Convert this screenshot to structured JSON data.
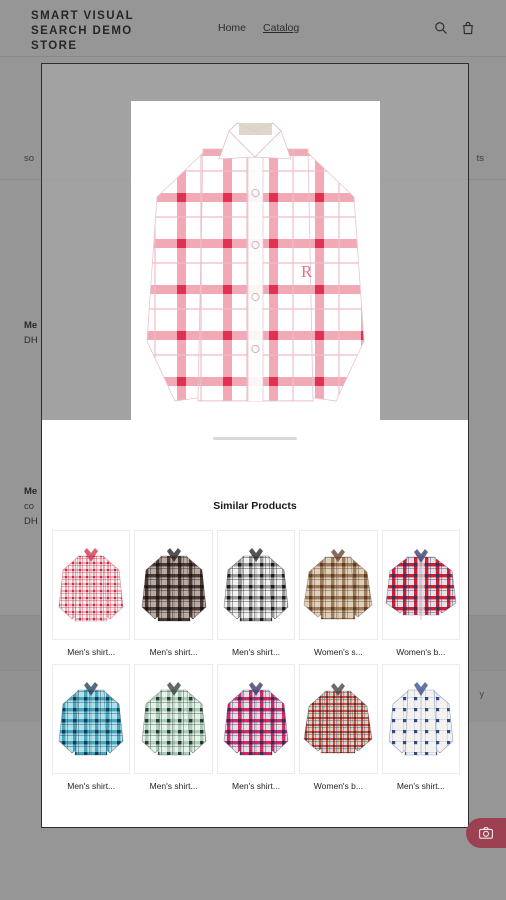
{
  "header": {
    "brand": "SMART VISUAL SEARCH DEMO STORE",
    "nav": [
      {
        "label": "Home",
        "active": false
      },
      {
        "label": "Catalog",
        "active": true
      }
    ],
    "icons": [
      {
        "name": "search-icon",
        "label": "Search"
      },
      {
        "name": "cart-icon",
        "label": "Cart"
      }
    ]
  },
  "background_page": {
    "sort_left": "so",
    "sort_right": "ts",
    "items": [
      {
        "title": "Me",
        "subtitle": "",
        "price": "DH",
        "right": ""
      },
      {
        "title": "Me",
        "subtitle": "co",
        "price": "DH",
        "right": ""
      }
    ],
    "footer_right": "y"
  },
  "modal": {
    "name": "visual-search-result-modal",
    "hero": {
      "name": "queried-product-photo",
      "alt": "Men's white shirt with pink and red plaid checks"
    },
    "sheet_title": "Similar Products",
    "drag_handle": "drag-handle"
  },
  "similar_products": [
    {
      "label": "Men's shirt...",
      "colors": [
        "#f6f4f3",
        "#e9aab4",
        "#cf2b45"
      ],
      "style": "plaid-fine",
      "shape": "mens"
    },
    {
      "label": "Men's shirt...",
      "colors": [
        "#b9aaa3",
        "#4b3b38",
        "#1d1715"
      ],
      "style": "plaid-bold",
      "shape": "mens"
    },
    {
      "label": "Men's shirt...",
      "colors": [
        "#f2f2f2",
        "#9a9a9a",
        "#1c1c1c"
      ],
      "style": "plaid-bold",
      "shape": "mens"
    },
    {
      "label": "Women's s...",
      "colors": [
        "#ded0bd",
        "#9d7c58",
        "#5d3a2a"
      ],
      "style": "plaid-bold",
      "shape": "womens"
    },
    {
      "label": "Women's b...",
      "colors": [
        "#e8e2e6",
        "#d01f34",
        "#2e3560"
      ],
      "style": "plaid-bold",
      "shape": "womens-open"
    },
    {
      "label": "Men's shirt...",
      "colors": [
        "#b4e2ea",
        "#45a6bd",
        "#1d3a52"
      ],
      "style": "plaid-bold",
      "shape": "mens"
    },
    {
      "label": "Men's shirt...",
      "colors": [
        "#e7f2ea",
        "#a9cdb6",
        "#2c3a33"
      ],
      "style": "plaid-bold",
      "shape": "mens"
    },
    {
      "label": "Men's shirt...",
      "colors": [
        "#e4e0ea",
        "#d8295e",
        "#2b2f63"
      ],
      "style": "plaid-bold",
      "shape": "mens"
    },
    {
      "label": "Women's b...",
      "colors": [
        "#d8d4d2",
        "#d24a3c",
        "#3d3a38"
      ],
      "style": "plaid-fine",
      "shape": "womens"
    },
    {
      "label": "Men's shirt...",
      "colors": [
        "#f3f2f0",
        "#c9cdd6",
        "#2d4a86"
      ],
      "style": "check-dot",
      "shape": "mens"
    }
  ],
  "camera_button": {
    "name": "visual-search-camera-button",
    "icon": "camera-icon",
    "color": "#9c4152"
  }
}
